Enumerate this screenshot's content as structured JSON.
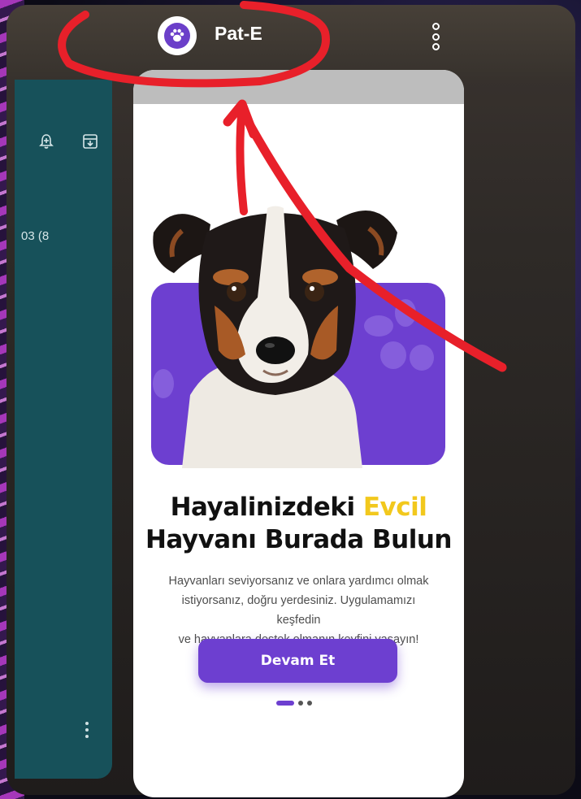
{
  "app": {
    "title": "Pat-E",
    "icon": "paw-icon",
    "brand_color": "#6d3fd0"
  },
  "background_app": {
    "partial_text": "03 (8",
    "icons": [
      "bell-plus-icon",
      "download-box-icon",
      "kebab-menu-icon"
    ]
  },
  "onboarding": {
    "headline_part1": "Hayalinizdeki ",
    "headline_accent": "Evcil",
    "headline_part2": "Hayvanı Burada Bulun",
    "description_line1": "Hayvanları seviyorsanız ve onlara yardımcı olmak",
    "description_line2": "istiyorsanız, doğru yerdesiniz. Uygulamamızı",
    "description_line3": "keşfedin",
    "description_line4": "ve hayvanlara destek olmanın keyfini yaşayın!",
    "cta_label": "Devam Et",
    "pager": {
      "current": 1,
      "total": 3
    },
    "accent_color": "#f2c81d"
  },
  "annotation": {
    "color": "#e8202a",
    "shapes": [
      "circle-around-title",
      "arrow-to-title"
    ]
  }
}
